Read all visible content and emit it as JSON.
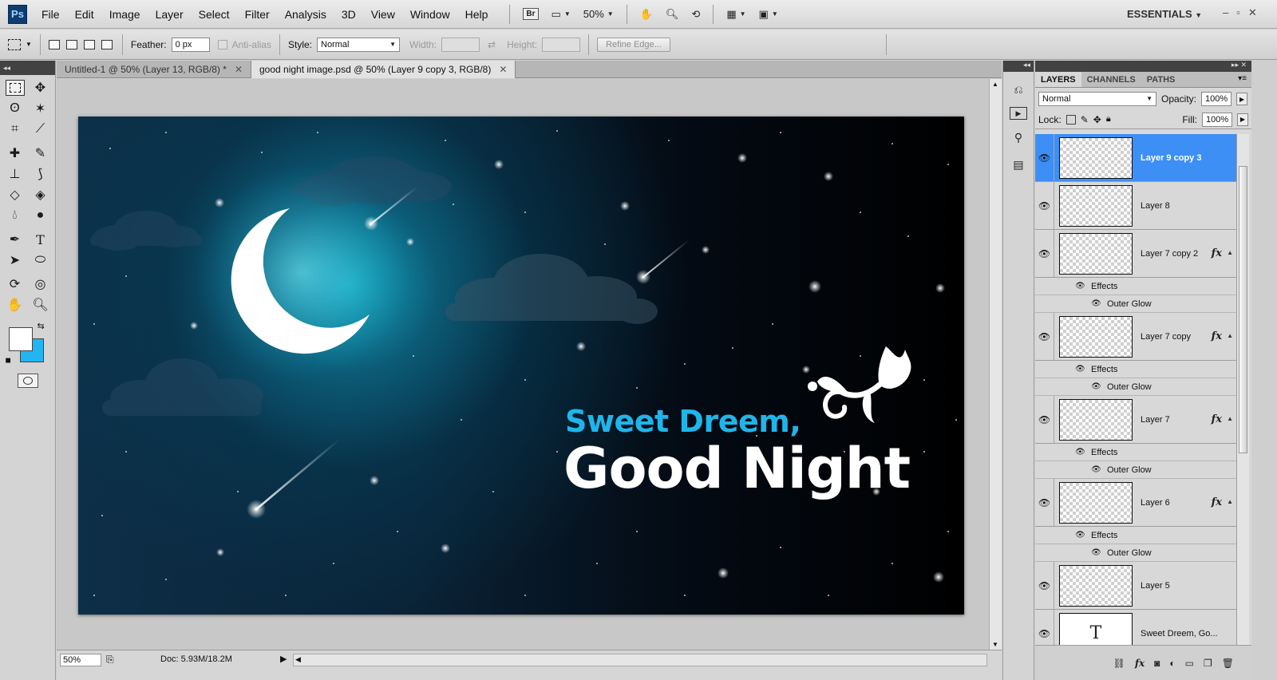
{
  "app": {
    "logo": "Ps"
  },
  "menu": [
    "File",
    "Edit",
    "Image",
    "Layer",
    "Select",
    "Filter",
    "Analysis",
    "3D",
    "View",
    "Window",
    "Help"
  ],
  "menubar": {
    "bridge": "Br",
    "zoom": "50%",
    "workspace": "ESSENTIALS",
    "window_min": "–",
    "window_restore": "▫",
    "window_close": "✕"
  },
  "options": {
    "feather_label": "Feather:",
    "feather_value": "0 px",
    "antialias_label": "Anti-alias",
    "style_label": "Style:",
    "style_value": "Normal",
    "width_label": "Width:",
    "height_label": "Height:",
    "refine_edge": "Refine Edge..."
  },
  "tabs": [
    {
      "label": "Untitled-1 @ 50% (Layer 13, RGB/8) *",
      "close": "✕"
    },
    {
      "label": "good night image.psd @ 50% (Layer 9 copy 3, RGB/8)",
      "close": "✕"
    }
  ],
  "artwork": {
    "tagline": "Sweet Dreem,",
    "headline": "Good Night"
  },
  "status": {
    "zoom": "50%",
    "doc": "Doc: 5.93M/18.2M"
  },
  "colors": {
    "foreground": "#ffffff",
    "background": "#22b5f2",
    "selection": "#3d8ff5"
  },
  "layers_panel": {
    "tabs": [
      "LAYERS",
      "CHANNELS",
      "PATHS"
    ],
    "blend_mode": "Normal",
    "opacity_label": "Opacity:",
    "opacity": "100%",
    "lock_label": "Lock:",
    "fill_label": "Fill:",
    "fill": "100%",
    "effects_label": "Effects",
    "outer_glow_label": "Outer Glow",
    "layers": [
      {
        "name": "Layer 9 copy 3",
        "selected": true,
        "fx": false,
        "thumb": "transparent"
      },
      {
        "name": "Layer 8",
        "selected": false,
        "fx": false,
        "thumb": "transparent"
      },
      {
        "name": "Layer 7 copy 2",
        "selected": false,
        "fx": true,
        "thumb": "transparent"
      },
      {
        "name": "Layer 7 copy",
        "selected": false,
        "fx": true,
        "thumb": "transparent"
      },
      {
        "name": "Layer 7",
        "selected": false,
        "fx": true,
        "thumb": "transparent"
      },
      {
        "name": "Layer 6",
        "selected": false,
        "fx": true,
        "thumb": "transparent"
      },
      {
        "name": "Layer 5",
        "selected": false,
        "fx": false,
        "thumb": "transparent"
      },
      {
        "name": "Sweet Dreem, Go...",
        "selected": false,
        "fx": false,
        "thumb": "text"
      }
    ]
  }
}
